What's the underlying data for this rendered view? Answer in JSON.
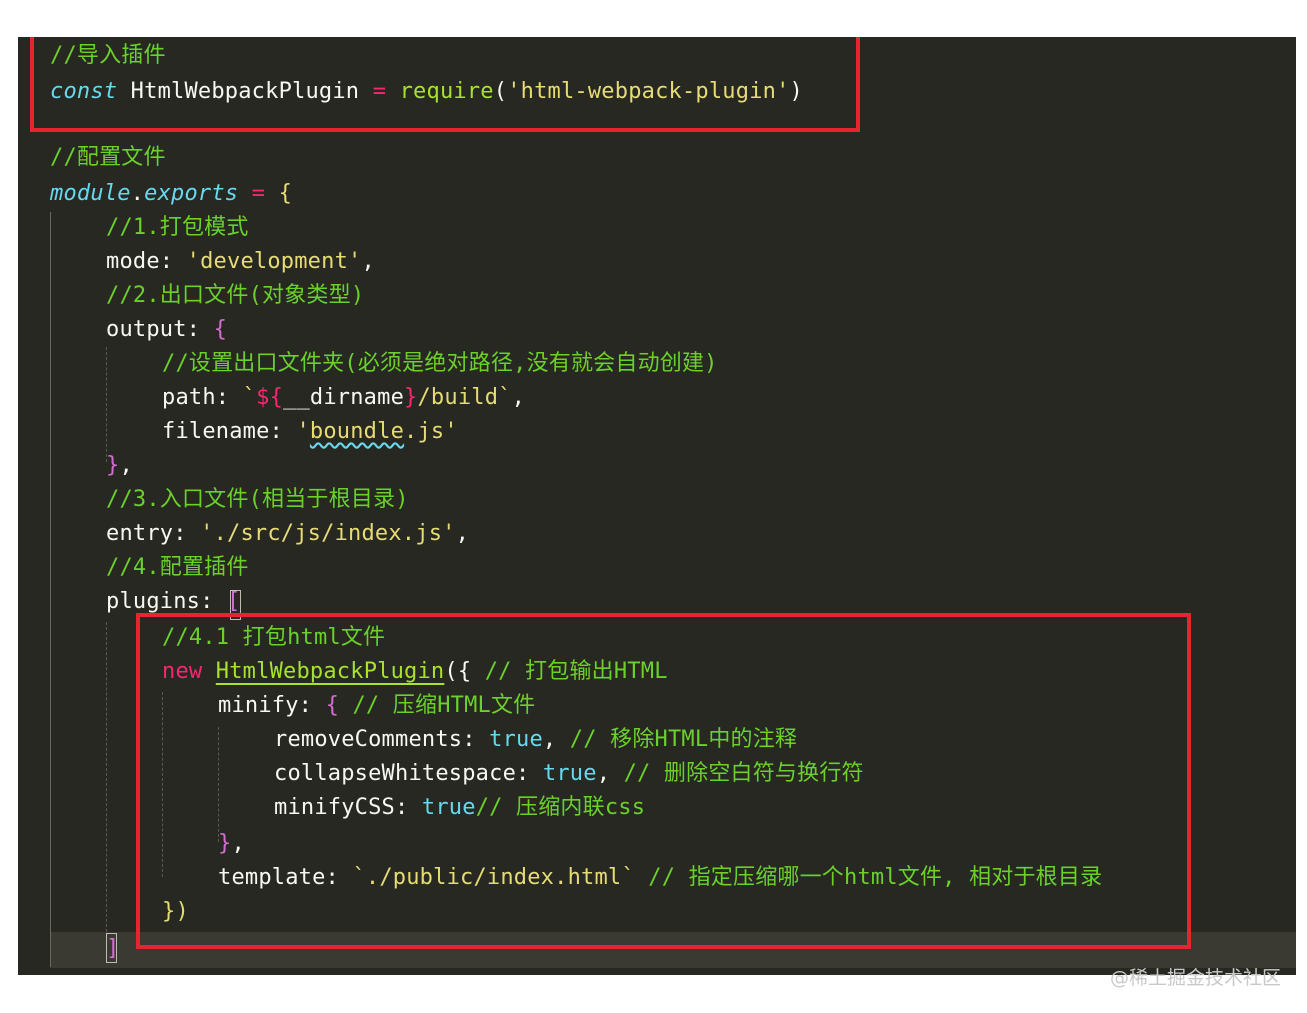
{
  "editor": {
    "lines": [
      {
        "id": "l1",
        "indent": 0,
        "tokens": [
          {
            "c": "c",
            "t": "//导入插件"
          }
        ]
      },
      {
        "id": "l2",
        "indent": 0,
        "tokens": [
          {
            "c": "k",
            "t": "const"
          },
          {
            "c": "t",
            "t": " HtmlWebpackPlugin "
          },
          {
            "c": "op",
            "t": "="
          },
          {
            "c": "t",
            "t": " "
          },
          {
            "c": "fn",
            "t": "require"
          },
          {
            "c": "p",
            "t": "("
          },
          {
            "c": "s",
            "t": "'html-webpack-plugin'"
          },
          {
            "c": "p",
            "t": ")"
          }
        ]
      },
      {
        "id": "l3",
        "indent": 0,
        "tokens": [
          {
            "c": "c",
            "t": "//配置文件"
          }
        ]
      },
      {
        "id": "l4",
        "indent": 0,
        "tokens": [
          {
            "c": "k",
            "t": "module"
          },
          {
            "c": "t",
            "t": "."
          },
          {
            "c": "k",
            "t": "exports"
          },
          {
            "c": "t",
            "t": " "
          },
          {
            "c": "op",
            "t": "="
          },
          {
            "c": "t",
            "t": " "
          },
          {
            "c": "b1",
            "t": "{"
          }
        ]
      },
      {
        "id": "l5",
        "indent": 1,
        "tokens": [
          {
            "c": "c",
            "t": "//1.打包模式"
          }
        ]
      },
      {
        "id": "l6",
        "indent": 1,
        "tokens": [
          {
            "c": "t",
            "t": "mode: "
          },
          {
            "c": "s",
            "t": "'development'"
          },
          {
            "c": "t",
            "t": ","
          }
        ]
      },
      {
        "id": "l7",
        "indent": 1,
        "tokens": [
          {
            "c": "c",
            "t": "//2.出口文件(对象类型)"
          }
        ]
      },
      {
        "id": "l8",
        "indent": 1,
        "tokens": [
          {
            "c": "t",
            "t": "output: "
          },
          {
            "c": "b2",
            "t": "{"
          }
        ]
      },
      {
        "id": "l9",
        "indent": 2,
        "tokens": [
          {
            "c": "c",
            "t": "//设置出口文件夹(必须是绝对路径,没有就会自动创建)"
          }
        ]
      },
      {
        "id": "l10",
        "indent": 2,
        "tokens": [
          {
            "c": "t",
            "t": "path: "
          },
          {
            "c": "s",
            "t": "`"
          },
          {
            "c": "op",
            "t": "${"
          },
          {
            "c": "t",
            "t": "__dirname"
          },
          {
            "c": "op",
            "t": "}"
          },
          {
            "c": "s",
            "t": "/build`"
          },
          {
            "c": "t",
            "t": ","
          }
        ]
      },
      {
        "id": "l11",
        "indent": 2,
        "tokens": [
          {
            "c": "t",
            "t": "filename: "
          },
          {
            "c": "s",
            "t": "'"
          },
          {
            "c": "s squiggle",
            "t": "boundle"
          },
          {
            "c": "s",
            "t": ".js'"
          }
        ]
      },
      {
        "id": "l12",
        "indent": 1,
        "tokens": [
          {
            "c": "b2",
            "t": "}"
          },
          {
            "c": "t",
            "t": ","
          }
        ]
      },
      {
        "id": "l13",
        "indent": 1,
        "tokens": [
          {
            "c": "c",
            "t": "//3.入口文件(相当于根目录)"
          }
        ]
      },
      {
        "id": "l14",
        "indent": 1,
        "tokens": [
          {
            "c": "t",
            "t": "entry: "
          },
          {
            "c": "s",
            "t": "'./src/js/index.js'"
          },
          {
            "c": "t",
            "t": ","
          }
        ]
      },
      {
        "id": "l15",
        "indent": 1,
        "tokens": [
          {
            "c": "c",
            "t": "//4.配置插件"
          }
        ]
      },
      {
        "id": "l16",
        "indent": 1,
        "tokens": [
          {
            "c": "t",
            "t": "plugins: "
          },
          {
            "c": "b2",
            "t": "["
          }
        ]
      },
      {
        "id": "l17",
        "indent": 2,
        "tokens": [
          {
            "c": "c",
            "t": "//4.1 打包html文件"
          }
        ]
      },
      {
        "id": "l18",
        "indent": 2,
        "tokens": [
          {
            "c": "kr",
            "t": "new"
          },
          {
            "c": "t",
            "t": " "
          },
          {
            "c": "fn ul",
            "t": "HtmlWebpackPlugin"
          },
          {
            "c": "p",
            "t": "({"
          },
          {
            "c": "t",
            "t": " "
          },
          {
            "c": "c",
            "t": "// 打包输出HTML"
          }
        ]
      },
      {
        "id": "l19",
        "indent": 3,
        "tokens": [
          {
            "c": "t",
            "t": "minify: "
          },
          {
            "c": "b2",
            "t": "{"
          },
          {
            "c": "t",
            "t": " "
          },
          {
            "c": "c",
            "t": "// 压缩HTML文件"
          }
        ]
      },
      {
        "id": "l20",
        "indent": 4,
        "tokens": [
          {
            "c": "t",
            "t": "removeComments: "
          },
          {
            "c": "bool",
            "t": "true"
          },
          {
            "c": "t",
            "t": ", "
          },
          {
            "c": "c",
            "t": "// 移除HTML中的注释"
          }
        ]
      },
      {
        "id": "l21",
        "indent": 4,
        "tokens": [
          {
            "c": "t",
            "t": "collapseWhitespace: "
          },
          {
            "c": "bool",
            "t": "true"
          },
          {
            "c": "t",
            "t": ", "
          },
          {
            "c": "c",
            "t": "// 删除空白符与换行符"
          }
        ]
      },
      {
        "id": "l22",
        "indent": 4,
        "tokens": [
          {
            "c": "t",
            "t": "minifyCSS: "
          },
          {
            "c": "bool",
            "t": "true"
          },
          {
            "c": "c",
            "t": "// 压缩内联css"
          }
        ]
      },
      {
        "id": "l23",
        "indent": 3,
        "tokens": [
          {
            "c": "b2",
            "t": "}"
          },
          {
            "c": "t",
            "t": ","
          }
        ]
      },
      {
        "id": "l24",
        "indent": 3,
        "tokens": [
          {
            "c": "t",
            "t": "template: "
          },
          {
            "c": "s",
            "t": "`./public/index.html`"
          },
          {
            "c": "t",
            "t": " "
          },
          {
            "c": "c",
            "t": "// 指定压缩哪一个html文件, 相对于根目录"
          }
        ]
      },
      {
        "id": "l25",
        "indent": 2,
        "tokens": [
          {
            "c": "b1",
            "t": "})"
          }
        ]
      },
      {
        "id": "l26",
        "indent": 1,
        "tokens": [
          {
            "c": "b2",
            "t": "]"
          }
        ]
      }
    ]
  },
  "watermark": "@稀土掘金技术社区",
  "colors": {
    "background": "#272822",
    "comment": "#6bd12a",
    "keyword": "#66d9ef",
    "string": "#e6db74",
    "operator": "#f92672",
    "highlight_box": "#e3262f"
  }
}
